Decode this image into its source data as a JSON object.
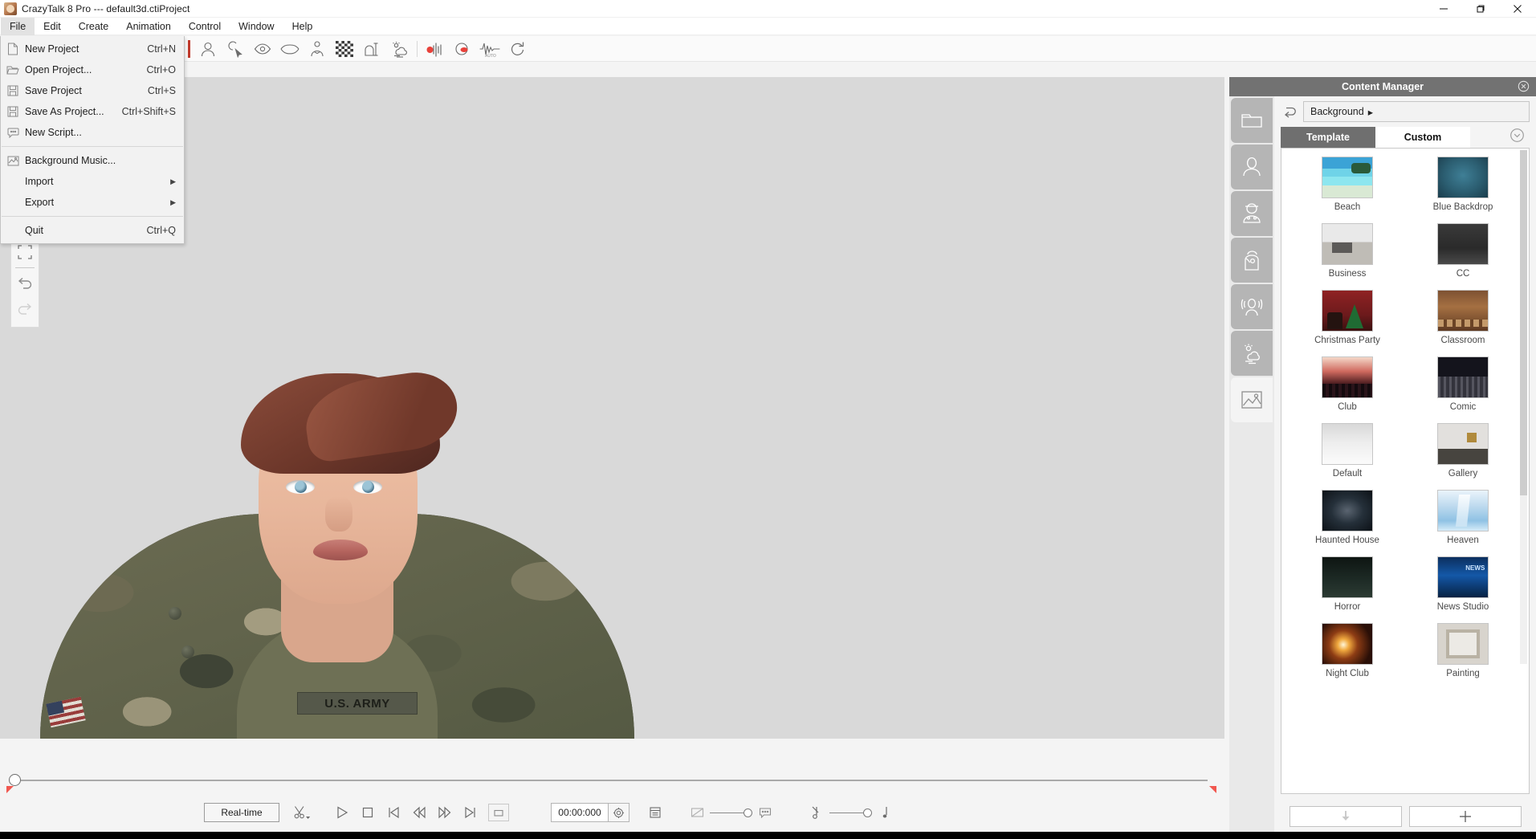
{
  "window": {
    "title": "CrazyTalk 8 Pro --- default3d.ctiProject",
    "app_icon": "app-avatar-icon",
    "controls": {
      "minimize": "minimize-icon",
      "maximize": "maximize-icon",
      "close": "close-icon"
    }
  },
  "menubar": {
    "items": [
      {
        "label": "File",
        "active": true
      },
      {
        "label": "Edit",
        "active": false
      },
      {
        "label": "Create",
        "active": false
      },
      {
        "label": "Animation",
        "active": false
      },
      {
        "label": "Control",
        "active": false
      },
      {
        "label": "Window",
        "active": false
      },
      {
        "label": "Help",
        "active": false
      }
    ]
  },
  "file_menu": {
    "open": true,
    "items": [
      {
        "icon": "new-document-icon",
        "label": "New Project",
        "accel": "Ctrl+N",
        "submenu": false,
        "separator_after": false
      },
      {
        "icon": "open-folder-icon",
        "label": "Open Project...",
        "accel": "Ctrl+O",
        "submenu": false,
        "separator_after": false
      },
      {
        "icon": "save-floppy-icon",
        "label": "Save Project",
        "accel": "Ctrl+S",
        "submenu": false,
        "separator_after": false
      },
      {
        "icon": "save-as-floppy-icon",
        "label": "Save As Project...",
        "accel": "Ctrl+Shift+S",
        "submenu": false,
        "separator_after": false
      },
      {
        "icon": "script-bubble-icon",
        "label": "New Script...",
        "accel": "",
        "submenu": false,
        "separator_after": true
      },
      {
        "icon": "music-image-icon",
        "label": "Background Music...",
        "accel": "",
        "submenu": false,
        "separator_after": false
      },
      {
        "icon": "",
        "label": "Import",
        "accel": "",
        "submenu": true,
        "separator_after": false
      },
      {
        "icon": "",
        "label": "Export",
        "accel": "",
        "submenu": true,
        "separator_after": true
      },
      {
        "icon": "",
        "label": "Quit",
        "accel": "Ctrl+Q",
        "submenu": false,
        "separator_after": false
      }
    ]
  },
  "toolbar": {
    "accent_color": "#c0392b",
    "buttons": [
      {
        "name": "head-icon",
        "tooltip": "Head"
      },
      {
        "name": "cursor-select-icon",
        "tooltip": "Select"
      },
      {
        "name": "eye-icon",
        "tooltip": "Eye"
      },
      {
        "name": "mouth-icon",
        "tooltip": "Mouth"
      },
      {
        "name": "avatar-body-icon",
        "tooltip": "Avatar"
      },
      {
        "name": "checkerboard-icon",
        "tooltip": "Transparency"
      },
      {
        "name": "text-frame-icon",
        "tooltip": "Text"
      },
      {
        "name": "weather-scene-icon",
        "tooltip": "Scene"
      },
      {
        "name": "record-audio-icon",
        "tooltip": "Record Audio"
      },
      {
        "name": "lipsync-icon",
        "tooltip": "Lip Sync"
      },
      {
        "name": "audio-waveform-icon",
        "tooltip": "Audio Waveform"
      },
      {
        "name": "refresh-arrow-icon",
        "tooltip": "Reset"
      }
    ]
  },
  "viewport": {
    "tools": [
      {
        "name": "fit-frame-icon"
      },
      {
        "name": "undo-icon",
        "enabled": true
      },
      {
        "name": "redo-icon",
        "enabled": false
      }
    ],
    "character": {
      "uniform_patch_text": "U.S. ARMY",
      "alt": "3D female soldier avatar in camouflage uniform"
    }
  },
  "timeline": {
    "playhead_position_pct": 0,
    "left_marker": "range-start-marker",
    "right_marker": "range-end-marker"
  },
  "playback": {
    "mode_label": "Real-time",
    "timecode": "00:00:000",
    "buttons": [
      {
        "name": "scissors-dropdown-icon",
        "label": ""
      },
      {
        "name": "play-icon",
        "label": ""
      },
      {
        "name": "stop-icon",
        "label": ""
      },
      {
        "name": "skip-to-start-icon",
        "label": ""
      },
      {
        "name": "step-back-icon",
        "label": ""
      },
      {
        "name": "step-forward-icon",
        "label": ""
      },
      {
        "name": "skip-to-end-icon",
        "label": ""
      },
      {
        "name": "loop-region-icon",
        "label": ""
      }
    ],
    "after_time": [
      {
        "name": "timecode-settings-gear-icon"
      },
      {
        "name": "timeline-list-icon"
      },
      {
        "name": "subtitle-off-icon"
      },
      {
        "name": "subtitle-volume-slider"
      },
      {
        "name": "subtitle-bubble-icon"
      },
      {
        "name": "audio-mute-icon"
      },
      {
        "name": "audio-volume-slider"
      },
      {
        "name": "audio-note-icon"
      }
    ]
  },
  "content_manager": {
    "title": "Content Manager",
    "close_icon": "close-circle-icon",
    "rail": [
      {
        "name": "folder-icon",
        "selected": false
      },
      {
        "name": "head-avatar-icon",
        "selected": false
      },
      {
        "name": "character-body-icon",
        "selected": false
      },
      {
        "name": "face-style-icon",
        "selected": false
      },
      {
        "name": "voice-motion-icon",
        "selected": false
      },
      {
        "name": "scene-weather-icon",
        "selected": false
      },
      {
        "name": "background-image-icon",
        "selected": true
      }
    ],
    "back_icon": "back-arrow-icon",
    "path": "Background",
    "path_arrow": "▸",
    "tabs": [
      {
        "label": "Template",
        "active": false
      },
      {
        "label": "Custom",
        "active": true
      }
    ],
    "expand_icon": "chevron-down-circle-icon",
    "items": [
      {
        "label": "Beach",
        "art": "t-beach"
      },
      {
        "label": "Blue Backdrop",
        "art": "t-blue"
      },
      {
        "label": "Business",
        "art": "t-business"
      },
      {
        "label": "CC",
        "art": "t-cc"
      },
      {
        "label": "Christmas Party",
        "art": "t-xmas"
      },
      {
        "label": "Classroom",
        "art": "t-class"
      },
      {
        "label": "Club",
        "art": "t-club"
      },
      {
        "label": "Comic",
        "art": "t-comic"
      },
      {
        "label": "Default",
        "art": "t-default"
      },
      {
        "label": "Gallery",
        "art": "t-gallery"
      },
      {
        "label": "Haunted House",
        "art": "t-haunt"
      },
      {
        "label": "Heaven",
        "art": "t-heaven"
      },
      {
        "label": "Horror",
        "art": "t-horror"
      },
      {
        "label": "News Studio",
        "art": "t-news"
      },
      {
        "label": "Night Club",
        "art": "t-night"
      },
      {
        "label": "Painting",
        "art": "t-paint"
      }
    ],
    "footer": [
      {
        "name": "download-arrow-button",
        "icon": "down-arrow-icon"
      },
      {
        "name": "add-content-button",
        "icon": "plus-icon"
      }
    ]
  }
}
